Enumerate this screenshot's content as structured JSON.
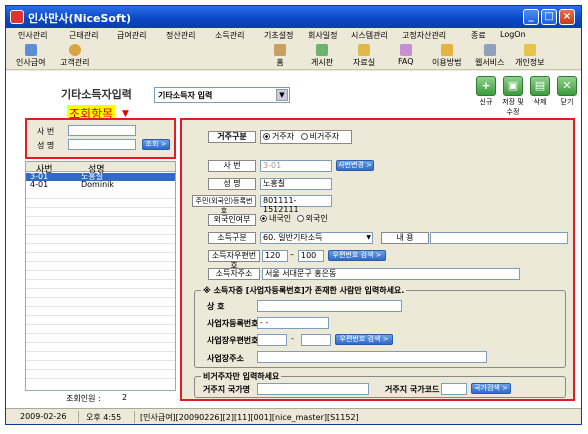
{
  "window": {
    "title": "인사만사(NiceSoft)"
  },
  "menu": [
    "인사관리",
    "근태관리",
    "급여관리",
    "정산관리",
    "소득관리",
    "기초설정",
    "회사일정",
    "시스템관리",
    "고정자산관리",
    "종료",
    "LogOn"
  ],
  "toolbar": {
    "left": [
      "인사급여",
      "고객관리"
    ],
    "right": [
      "홈",
      "게시판",
      "자료실",
      "FAQ",
      "이용방법",
      "웹서비스",
      "개인정보"
    ]
  },
  "page": {
    "title": "기타소득자입력",
    "type_select": "기타소득자 입력",
    "annotation": "조회항목",
    "actions": [
      "신규",
      "저장 및 수정",
      "삭제",
      "닫기"
    ]
  },
  "search": {
    "sabun_label": "사    번",
    "name_label": "성    명",
    "sabun_value": "",
    "name_value": "",
    "button": "조회 >"
  },
  "list": {
    "headers": [
      "사번",
      "성명"
    ],
    "rows": [
      [
        "3-01",
        "노홍칠"
      ],
      [
        "4-01",
        "Dominik"
      ]
    ],
    "count_label": "조회인원 :",
    "count_value": "2"
  },
  "form": {
    "residency_label": "거주구분",
    "residency_options": [
      "거주자",
      "비거주자"
    ],
    "sabun_label": "사  번",
    "sabun_value": "3-01",
    "sabun_button": "사번변경 >",
    "name_label": "성  명",
    "name_value": "노홍칠",
    "rrn_label": "주민(외국인)등록번호",
    "rrn_value": "801111-1512111",
    "foreigner_label": "외국인여부",
    "foreigner_options": [
      "내국인",
      "외국인"
    ],
    "income_type_label": "소득구분",
    "income_type_value": "60. 일반기타소득",
    "content_label": "내  용",
    "content_value": "",
    "zip_label": "소득자우편번호",
    "zip1": "120",
    "zip2": "100",
    "zip_button": "우편번호 검색 >",
    "address_label": "소득자주소",
    "address_value": "서울 서대문구 홍은동",
    "biz_legend": "※ 소득자중 [사업자등록번호]가 존재한 사람만 입력하세요.",
    "biz_name_label": "상  호",
    "biz_no_label": "사업자등록번호",
    "biz_no_value": "- -",
    "biz_zip_label": "사업장우편번호",
    "biz_zip_dash": "-",
    "biz_zip_button": "우편번호 검색 >",
    "biz_addr_label": "사업장주소",
    "nonres_legend": "비거주자만 입력하세요",
    "country_name_label": "거주지 국가명",
    "country_code_label": "거주지 국가코드",
    "country_button": "국가검색 >"
  },
  "status": [
    "2009-02-26",
    "오후 4:55",
    "[인사급여][20090226][2][11][001][nice_master][S1152]"
  ]
}
